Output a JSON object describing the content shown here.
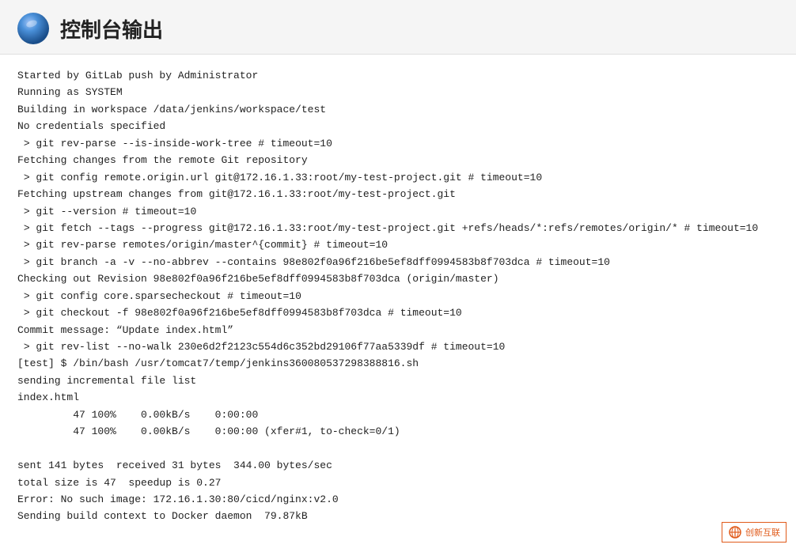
{
  "header": {
    "title": "控制台输出",
    "icon_alt": "console-output-icon"
  },
  "console": {
    "lines": [
      "Started by GitLab push by Administrator",
      "Running as SYSTEM",
      "Building in workspace /data/jenkins/workspace/test",
      "No credentials specified",
      " > git rev-parse --is-inside-work-tree # timeout=10",
      "Fetching changes from the remote Git repository",
      " > git config remote.origin.url git@172.16.1.33:root/my-test-project.git # timeout=10",
      "Fetching upstream changes from git@172.16.1.33:root/my-test-project.git",
      " > git --version # timeout=10",
      " > git fetch --tags --progress git@172.16.1.33:root/my-test-project.git +refs/heads/*:refs/remotes/origin/* # timeout=10",
      " > git rev-parse remotes/origin/master^{commit} # timeout=10",
      " > git branch -a -v --no-abbrev --contains 98e802f0a96f216be5ef8dff0994583b8f703dca # timeout=10",
      "Checking out Revision 98e802f0a96f216be5ef8dff0994583b8f703dca (origin/master)",
      " > git config core.sparsecheckout # timeout=10",
      " > git checkout -f 98e802f0a96f216be5ef8dff0994583b8f703dca # timeout=10",
      "Commit message: “Update index.html”",
      " > git rev-list --no-walk 230e6d2f2123c554d6c352bd29106f77aa5339df # timeout=10",
      "[test] $ /bin/bash /usr/tomcat7/temp/jenkins360080537298388816.sh",
      "sending incremental file list",
      "index.html",
      "         47 100%    0.00kB/s    0:00:00",
      "         47 100%    0.00kB/s    0:00:00 (xfer#1, to-check=0/1)",
      "",
      "sent 141 bytes  received 31 bytes  344.00 bytes/sec",
      "total size is 47  speedup is 0.27",
      "Error: No such image: 172.16.1.30:80/cicd/nginx:v2.0",
      "Sending build context to Docker daemon  79.87kB"
    ]
  },
  "watermark": {
    "text": "创新互联",
    "icon": "link-icon"
  }
}
